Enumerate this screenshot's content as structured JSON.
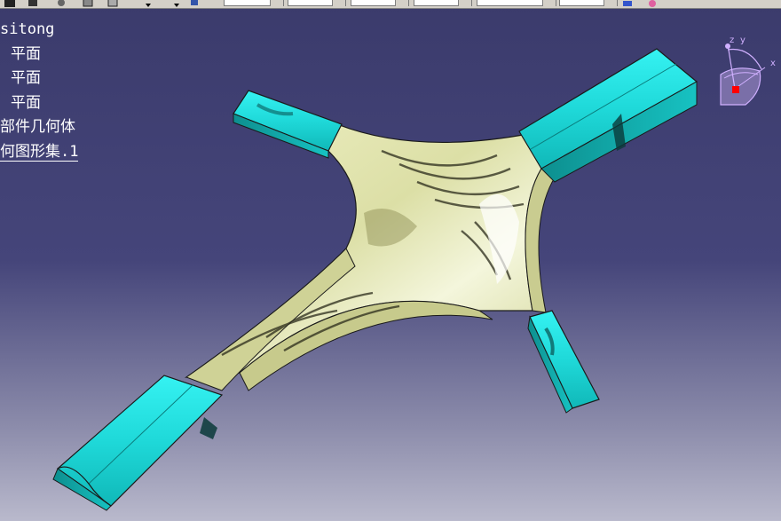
{
  "tree": {
    "root": "sitong",
    "planes": [
      "平面",
      "平面",
      "平面"
    ],
    "part_body": "部件几何体",
    "geo_set": "何图形集.1"
  },
  "compass": {
    "label_z": "z",
    "label_y": "y",
    "label_x": "x"
  },
  "colors": {
    "background_top": "#3b3b6c",
    "background_bottom": "#b9b9cc",
    "surface": "#e6e8b4",
    "pipe": "#1fe3e3",
    "tree_text": "#ffffff",
    "compass": "#d0b0ff"
  }
}
